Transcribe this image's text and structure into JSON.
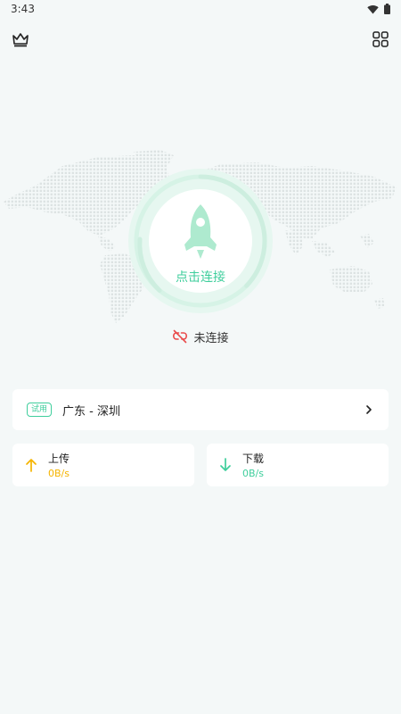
{
  "status_bar": {
    "time": "3:43",
    "icons": [
      "wifi-icon",
      "battery-icon"
    ]
  },
  "header": {
    "left_icon": "crown-icon",
    "right_icon": "apps-grid-icon"
  },
  "connect": {
    "label": "点击连接",
    "icon": "rocket-icon"
  },
  "connection_status": {
    "text": "未连接",
    "icon": "disconnected-link-icon",
    "icon_color": "#e94a4a"
  },
  "server": {
    "badge": "试用",
    "name": "广东 - 深圳",
    "chevron": "chevron-right-icon"
  },
  "upload": {
    "title": "上传",
    "value": "0B/s",
    "icon": "arrow-up-icon",
    "color": "#f5b400"
  },
  "download": {
    "title": "下载",
    "value": "0B/s",
    "icon": "arrow-down-icon",
    "color": "#3fce9c"
  },
  "colors": {
    "accent": "#3fce9c",
    "background": "#f4f8f8",
    "warning": "#f5b400",
    "error": "#e94a4a"
  }
}
